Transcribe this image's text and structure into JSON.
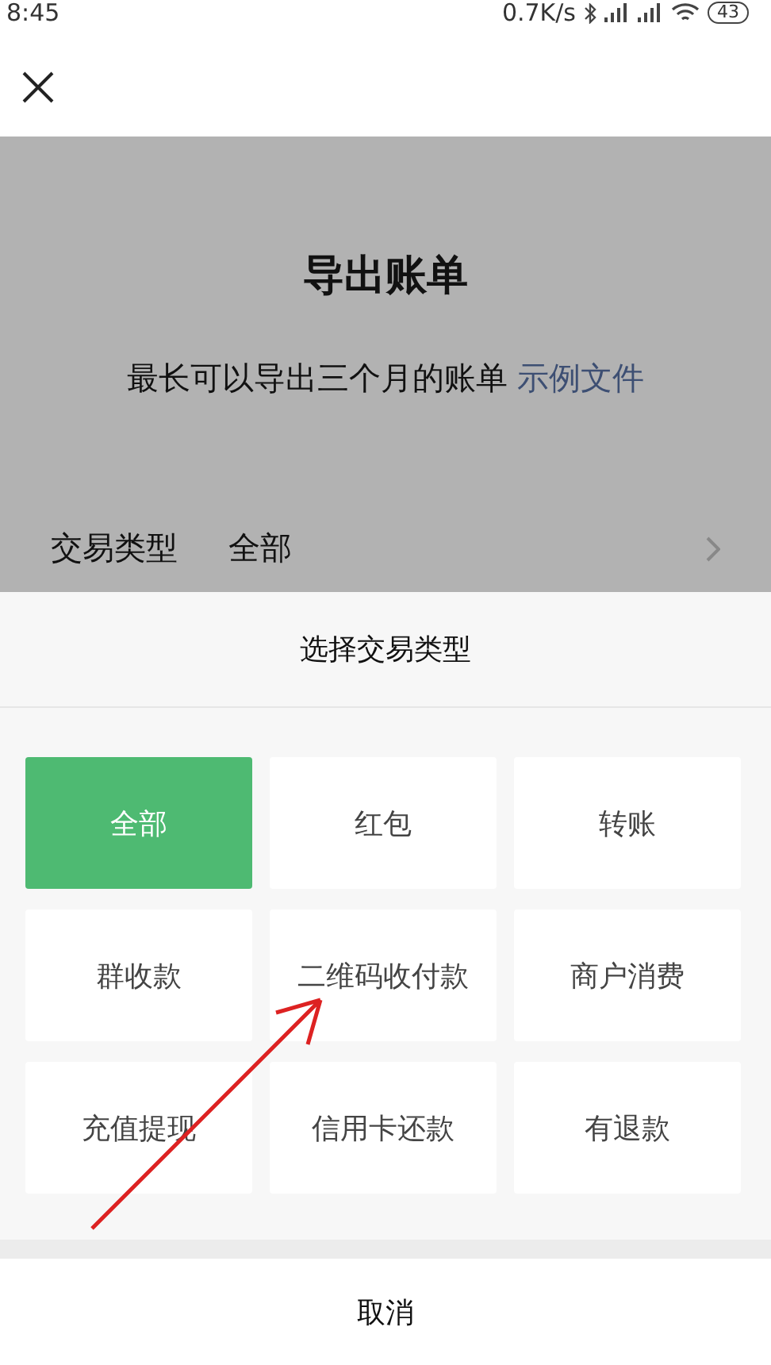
{
  "status_bar": {
    "time": "8:45",
    "speed": "0.7K/s",
    "battery": "43"
  },
  "page": {
    "title": "导出账单",
    "subtitle": "最长可以导出三个月的账单",
    "link": "示例文件",
    "row_label": "交易类型",
    "row_value": "全部"
  },
  "sheet": {
    "title": "选择交易类型",
    "options": [
      {
        "label": "全部",
        "selected": true
      },
      {
        "label": "红包",
        "selected": false
      },
      {
        "label": "转账",
        "selected": false
      },
      {
        "label": "群收款",
        "selected": false
      },
      {
        "label": "二维码收付款",
        "selected": false
      },
      {
        "label": "商户消费",
        "selected": false
      },
      {
        "label": "充值提现",
        "selected": false
      },
      {
        "label": "信用卡还款",
        "selected": false
      },
      {
        "label": "有退款",
        "selected": false
      }
    ],
    "cancel": "取消"
  }
}
